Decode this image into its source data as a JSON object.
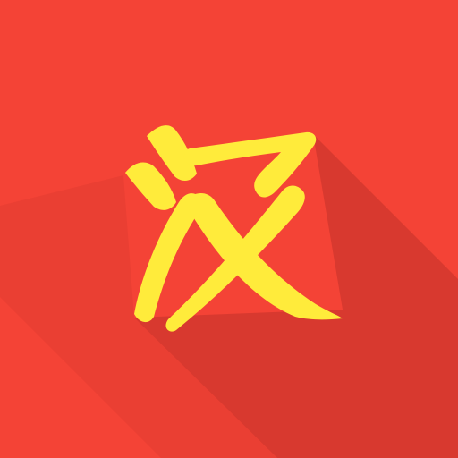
{
  "app_icon": {
    "glyph_name": "han-character-icon",
    "character": "汉",
    "colors": {
      "background": "#f44336",
      "long_shadow": "#d8392f",
      "glyph": "#ffeb3b"
    }
  }
}
